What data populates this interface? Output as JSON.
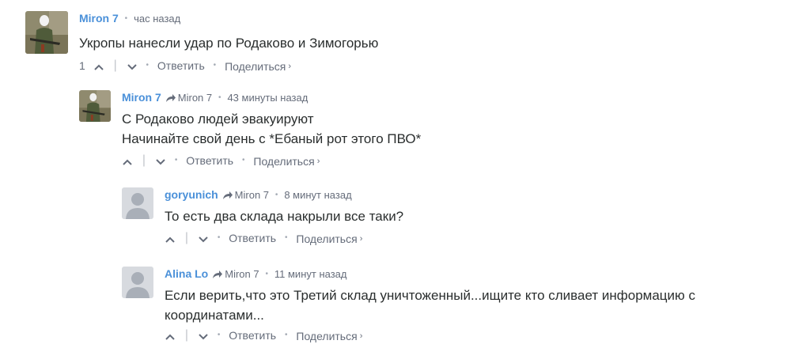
{
  "comments": [
    {
      "author": "Miron 7",
      "reply_to": "",
      "time": "час назад",
      "lines": [
        "Укропы нанесли удар по Родаково и Зимогорью"
      ],
      "votes": "1",
      "reply_label": "Ответить",
      "share_label": "Поделиться",
      "avatar": "photo-avatar-icon"
    },
    {
      "author": "Miron 7",
      "reply_to": "Miron 7",
      "time": "43 минуты назад",
      "lines": [
        "С Родаково людей эвакуируют",
        "Начинайте свой день с *Ебаный рот этого ПВО*"
      ],
      "votes": "",
      "reply_label": "Ответить",
      "share_label": "Поделиться",
      "avatar": "photo-avatar-icon"
    },
    {
      "author": "goryunich",
      "reply_to": "Miron 7",
      "time": "8 минут назад",
      "lines": [
        "То есть два склада накрыли все таки?"
      ],
      "votes": "",
      "reply_label": "Ответить",
      "share_label": "Поделиться",
      "avatar": "default-avatar-icon"
    },
    {
      "author": "Alina Lo",
      "reply_to": "Miron 7",
      "time": "11 минут назад",
      "lines": [
        "Если верить,что это Третий склад уничтоженный...ищите кто сливает информацию с",
        "координатами..."
      ],
      "votes": "",
      "reply_label": "Ответить",
      "share_label": "Поделиться",
      "avatar": "default-avatar-icon"
    }
  ],
  "colors": {
    "author": "#4a90d9",
    "meta": "#656c7a",
    "text": "#2a2e2e",
    "default_avatar_bg": "#d7dadf",
    "default_avatar_fg": "#a9afb8"
  }
}
